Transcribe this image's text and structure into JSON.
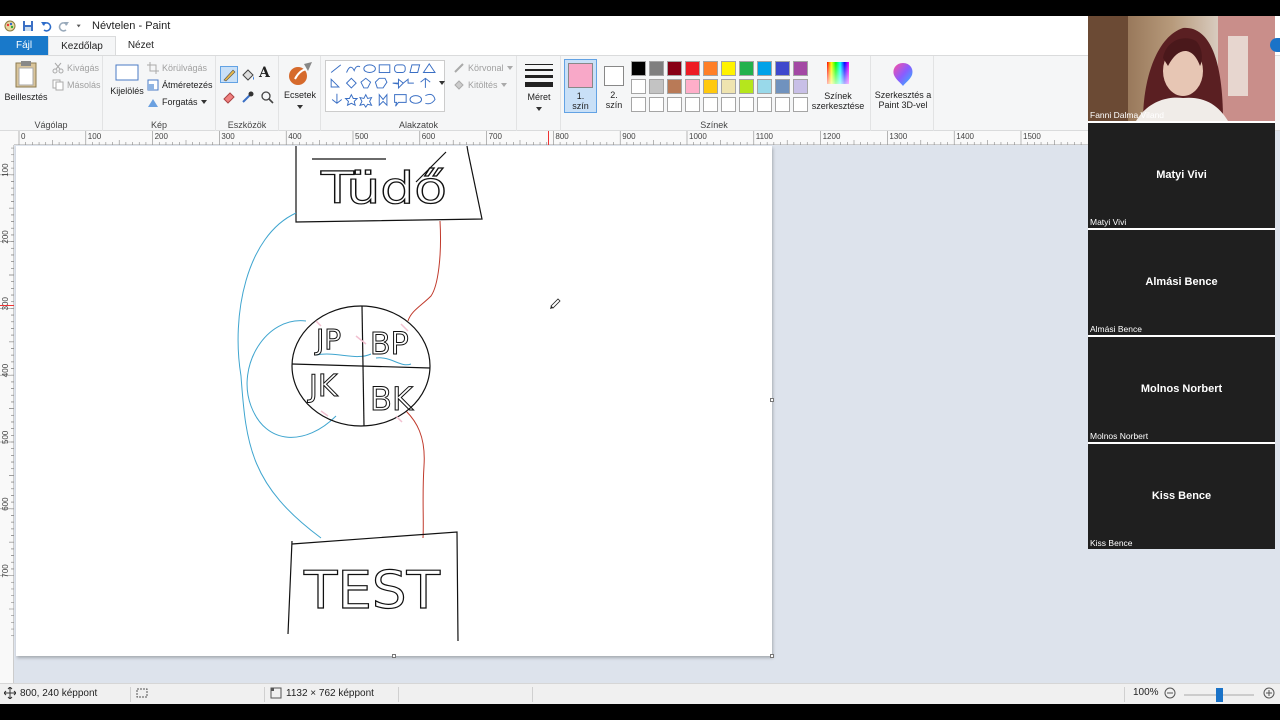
{
  "window": {
    "title": "Névtelen - Paint"
  },
  "tabs": [
    {
      "label": "Fájl"
    },
    {
      "label": "Kezdőlap"
    },
    {
      "label": "Nézet"
    }
  ],
  "ribbon": {
    "clipboard": {
      "paste": "Beillesztés",
      "cut": "Kivágás",
      "copy": "Másolás",
      "label": "Vágólap"
    },
    "image": {
      "select": "Kijelölés",
      "crop": "Körülvágás",
      "resize": "Átméretezés",
      "rotate": "Forgatás",
      "label": "Kép"
    },
    "tools": {
      "label": "Eszközök"
    },
    "brushes": {
      "label": "Ecsetek"
    },
    "shapes": {
      "outline": "Körvonal",
      "fill": "Kitöltés",
      "label": "Alakzatok"
    },
    "size": {
      "label": "Méret"
    },
    "color1": {
      "label_a": "1.",
      "label_b": "szín",
      "color": "#f8a8c8"
    },
    "color2": {
      "label_a": "2.",
      "label_b": "szín",
      "color": "#ffffff"
    },
    "colors": {
      "label": "Színek",
      "row1": [
        "#000000",
        "#7f7f7f",
        "#880015",
        "#ed1c24",
        "#ff7f27",
        "#fff200",
        "#22b14c",
        "#00a2e8",
        "#3f48cc",
        "#a349a4"
      ],
      "row2": [
        "#ffffff",
        "#c3c3c3",
        "#b97a57",
        "#ffaec9",
        "#ffc90e",
        "#efe4b0",
        "#b5e61d",
        "#99d9ea",
        "#7092be",
        "#c8bfe7"
      ],
      "row3": [
        "#ffffff",
        "#ffffff",
        "#ffffff",
        "#ffffff",
        "#ffffff",
        "#ffffff",
        "#ffffff",
        "#ffffff",
        "#ffffff",
        "#ffffff"
      ]
    },
    "edit_colors": {
      "line1": "Színek",
      "line2": "szerkesztése"
    },
    "paint3d": {
      "line1": "Szerkesztés a",
      "line2": "Paint 3D-vel"
    }
  },
  "ruler": {
    "h_ticks": [
      "0",
      "100",
      "200",
      "300",
      "400",
      "500",
      "600",
      "700",
      "800",
      "900",
      "1000",
      "1100",
      "1200",
      "1300",
      "1400",
      "1500"
    ],
    "v_ticks": [
      "100",
      "200",
      "300",
      "400",
      "500",
      "600",
      "700"
    ]
  },
  "drawing": {
    "top_box_text": "Tüdő",
    "bottom_box_text": "TEST",
    "quadrants": [
      "JP",
      "BP",
      "JK",
      "BK"
    ]
  },
  "status": {
    "cursor_pos": "800, 240 képpont",
    "selection": "",
    "canvas_size": "1132 × 762 képpont",
    "zoom": "100%",
    "zoom_level": 0.5
  },
  "participants": [
    {
      "name": "Fanni Dalma Viland",
      "video": true
    },
    {
      "name": "Matyi Vivi",
      "video": false
    },
    {
      "name": "Almási Bence",
      "video": false
    },
    {
      "name": "Molnos Norbert",
      "video": false
    },
    {
      "name": "Kiss Bence",
      "video": false
    }
  ]
}
